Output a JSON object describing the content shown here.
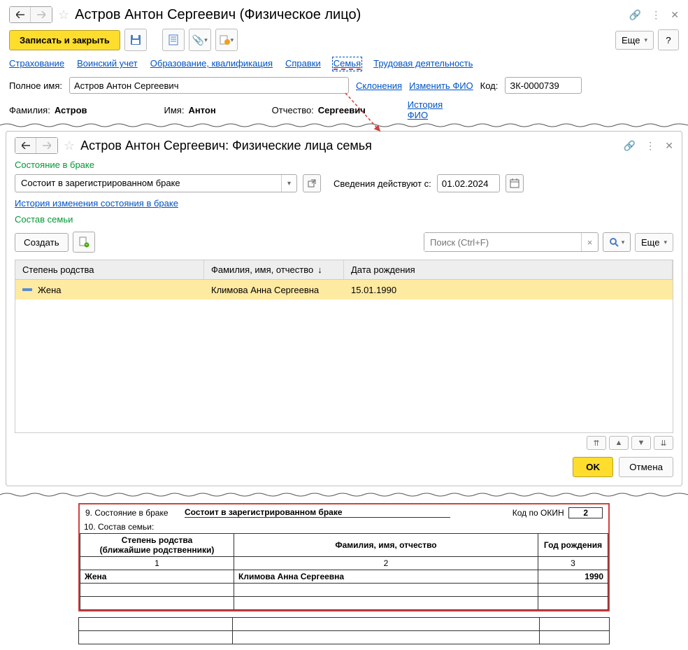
{
  "win1": {
    "title": "Астров Антон Сергеевич (Физическое лицо)",
    "save": "Записать и закрыть",
    "esche": "Еще",
    "help": "?",
    "links": [
      "Страхование",
      "Воинский учет",
      "Образование, квалификация",
      "Справки",
      "Семья",
      "Трудовая деятельность"
    ],
    "fullname_lbl": "Полное имя:",
    "fullname_val": "Астров Антон Сергеевич",
    "decl": "Склонения",
    "changefio": "Изменить ФИО",
    "code_lbl": "Код:",
    "code_val": "ЗК-0000739",
    "fam_lbl": "Фамилия:",
    "fam_val": "Астров",
    "nam_lbl": "Имя:",
    "nam_val": "Антон",
    "otc_lbl": "Отчество:",
    "otc_val": "Сергеевич",
    "histfio": "История ФИО"
  },
  "win2": {
    "title": "Астров Антон Сергеевич: Физические лица семья",
    "marital_section": "Состояние в браке",
    "marital_val": "Состоит в зарегистрированном браке",
    "valid_lbl": "Сведения действуют с:",
    "valid_date": "01.02.2024",
    "history_link": "История изменения состояния в браке",
    "family_section": "Состав семьи",
    "create": "Создать",
    "search_ph": "Поиск (Ctrl+F)",
    "esche": "Еще",
    "cols": [
      "Степень родства",
      "Фамилия, имя, отчество",
      "Дата рождения"
    ],
    "row": {
      "rel": "Жена",
      "fio": "Климова Анна Сергеевна",
      "dob": "15.01.1990"
    },
    "ok": "OK",
    "cancel": "Отмена"
  },
  "print": {
    "line9_lbl": "9. Состояние в браке",
    "line9_val": "Состоит в зарегистрированном браке",
    "okin_lbl": "Код по ОКИН",
    "okin_val": "2",
    "line10_lbl": "10. Состав семьи:",
    "h1": "Степень родства",
    "h1b": "(ближайшие родственники)",
    "h2": "Фамилия, имя, отчество",
    "h3": "Год рождения",
    "n1": "1",
    "n2": "2",
    "n3": "3",
    "r_rel": "Жена",
    "r_fio": "Климова Анна Сергеевна",
    "r_year": "1990"
  }
}
